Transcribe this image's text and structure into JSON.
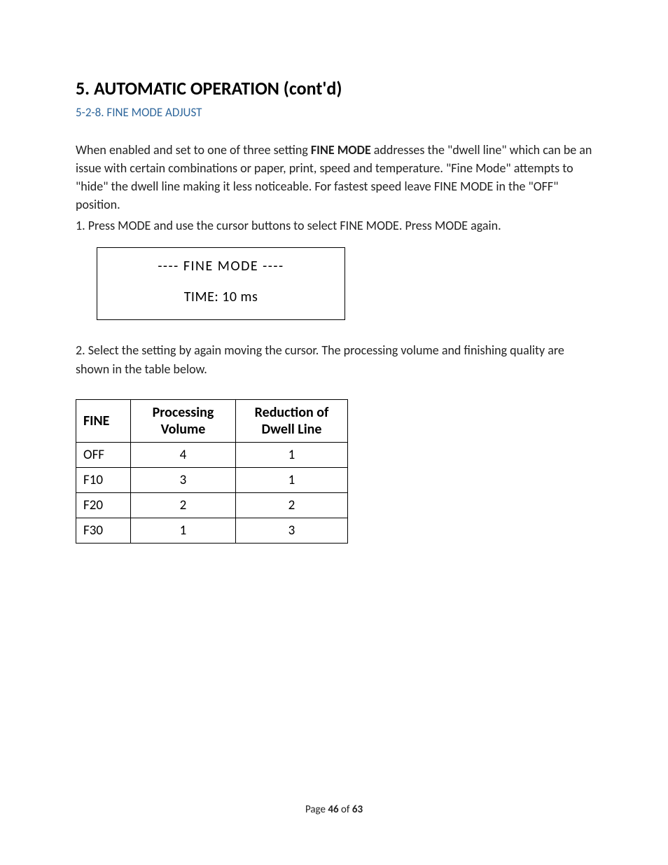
{
  "heading": "5. AUTOMATIC OPERATION (cont'd)",
  "subheading": "5-2-8. FINE MODE ADJUST",
  "para1": {
    "pre": "When enabled and set to one of three setting ",
    "bold": "FINE MODE",
    "post": " addresses the \"dwell line\" which can be an issue with certain combinations or paper, print, speed and temperature. \"Fine Mode\" attempts to \"hide\" the dwell line making it less noticeable. For fastest speed leave FINE MODE in the \"OFF\" position."
  },
  "step1": "1. Press MODE and use the cursor buttons to select FINE MODE. Press MODE again.",
  "display": {
    "line1": "----  FINE  MODE  ----",
    "line2": "TIME:   10 ms"
  },
  "step2": "2. Select the setting by again moving the cursor. The processing volume and finishing quality are shown in the table below.",
  "table": {
    "headers": {
      "c1": "FINE",
      "c2": "Processing Volume",
      "c3": "Reduction of Dwell Line"
    },
    "rows": [
      {
        "label": "OFF",
        "vol": "4",
        "red": "1"
      },
      {
        "label": "F10",
        "vol": "3",
        "red": "1"
      },
      {
        "label": "F20",
        "vol": "2",
        "red": "2"
      },
      {
        "label": "F30",
        "vol": "1",
        "red": "3"
      }
    ]
  },
  "footer": {
    "pre": "Page ",
    "cur": "46",
    "mid": " of ",
    "total": "63"
  }
}
